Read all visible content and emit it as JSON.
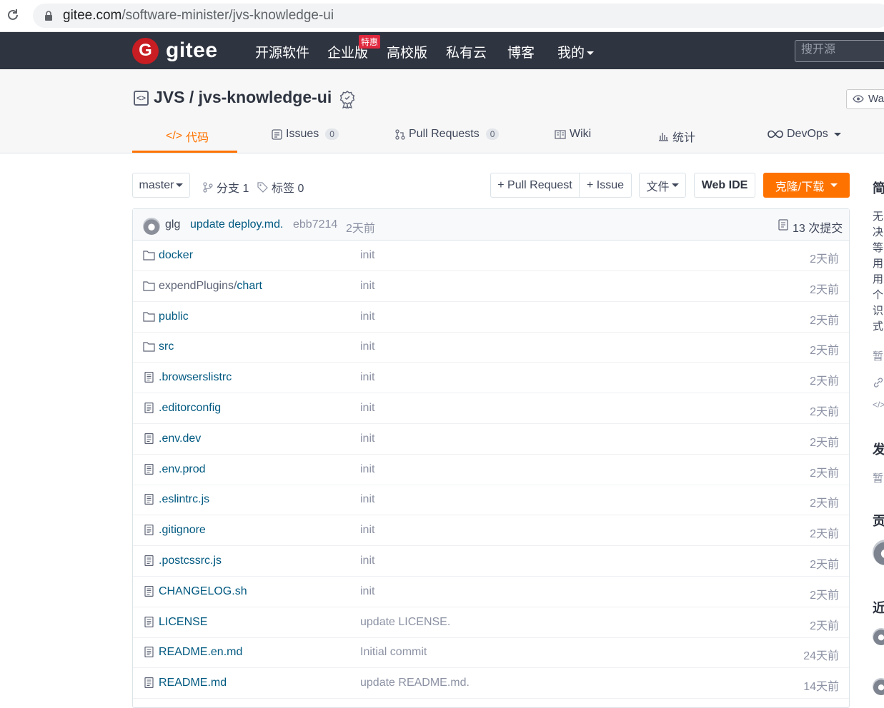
{
  "browser": {
    "url_domain": "gitee.com",
    "url_path": "/software-minister/jvs-knowledge-ui"
  },
  "nav": {
    "logo_letter": "G",
    "logo_text": "gitee",
    "items": [
      "开源软件",
      "企业版",
      "高校版",
      "私有云",
      "博客",
      "我的"
    ],
    "badge": "特惠",
    "search_placeholder": "搜开源"
  },
  "repo": {
    "title": "JVS / jvs-knowledge-ui",
    "watch_label": "Wat",
    "tabs": {
      "code": "代码",
      "issues": "Issues",
      "issues_count": "0",
      "pr": "Pull Requests",
      "pr_count": "0",
      "wiki": "Wiki",
      "stats": "统计",
      "devops": "DevOps"
    }
  },
  "toolbar": {
    "branch": "master",
    "branches": "分支 1",
    "tags": "标签 0",
    "new_pr": "+ Pull Request",
    "new_issue": "+ Issue",
    "file_menu": "文件",
    "web_ide": "Web IDE",
    "clone": "克隆/下载"
  },
  "latest_commit": {
    "author": "glg",
    "message": "update deploy.md.",
    "hash": "ebb7214",
    "time": "2天前",
    "count": "13 次提交"
  },
  "files": [
    {
      "type": "dir",
      "name": "docker",
      "msg": "init",
      "time": "2天前"
    },
    {
      "type": "dir",
      "name": "expendPlugins/",
      "name2": "chart",
      "msg": "init",
      "time": "2天前"
    },
    {
      "type": "dir",
      "name": "public",
      "msg": "init",
      "time": "2天前"
    },
    {
      "type": "dir",
      "name": "src",
      "msg": "init",
      "time": "2天前"
    },
    {
      "type": "file",
      "name": ".browserslistrc",
      "msg": "init",
      "time": "2天前"
    },
    {
      "type": "file",
      "name": ".editorconfig",
      "msg": "init",
      "time": "2天前"
    },
    {
      "type": "file",
      "name": ".env.dev",
      "msg": "init",
      "time": "2天前"
    },
    {
      "type": "file",
      "name": ".env.prod",
      "msg": "init",
      "time": "2天前"
    },
    {
      "type": "file",
      "name": ".eslintrc.js",
      "msg": "init",
      "time": "2天前"
    },
    {
      "type": "file",
      "name": ".gitignore",
      "msg": "init",
      "time": "2天前"
    },
    {
      "type": "file",
      "name": ".postcssrc.js",
      "msg": "init",
      "time": "2天前"
    },
    {
      "type": "file",
      "name": "CHANGELOG.sh",
      "msg": "init",
      "time": "2天前"
    },
    {
      "type": "file",
      "name": "LICENSE",
      "msg": "update LICENSE.",
      "time": "2天前"
    },
    {
      "type": "file",
      "name": "README.en.md",
      "msg": "Initial commit",
      "time": "24天前"
    },
    {
      "type": "file",
      "name": "README.md",
      "msg": "update README.md.",
      "time": "14天前"
    }
  ],
  "sidebar": {
    "h1": "简",
    "text": [
      "无",
      "决",
      "等",
      "用",
      "用",
      "个",
      "识",
      "式"
    ],
    "none1": "暂",
    "h2": "发",
    "none2": "暂",
    "h3": "贡",
    "h4": "近"
  },
  "colors": {
    "nav_bg": "#2e3440",
    "accent": "#fe7300",
    "link": "#005980",
    "logo_red": "#c71d23"
  }
}
